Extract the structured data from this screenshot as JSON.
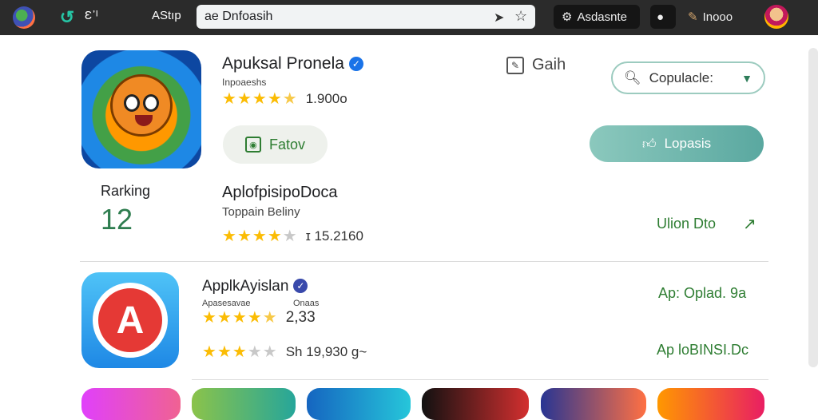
{
  "topbar": {
    "back_label": "ᴇ",
    "app_label": "Ɛ᾿ᴵ",
    "store_label": "AStıp",
    "search_value": "ae Dnfoasih",
    "account_label": "Asdasnte",
    "user_label": "Inooo"
  },
  "app1": {
    "title": "Apuksal Pronela",
    "developer": "Inpoaeshs",
    "rating": "1.900o",
    "stars": 4.5,
    "gaih_label": "Gaih",
    "dropdown_label": "Copulacle:",
    "action_label": "Fatov",
    "install_label": "Lopasis"
  },
  "ranking": {
    "label": "Rarking",
    "value": "12"
  },
  "app2": {
    "title": "AplofpisipoDoca",
    "subtitle": "Toppain Beliny",
    "rating": "ɪ 15.2160",
    "stars": 4,
    "link_label": "Ulion Dto",
    "link_icon": "trend-arrow-icon"
  },
  "app3": {
    "title": "ApplkAyislan",
    "developer_left": "Apasesavae",
    "developer_right": "Onaas",
    "rating": "2,33",
    "stars": 4.5,
    "rating2": "Ѕh 19,930 g~",
    "stars2": 3,
    "link1": "Ap: Oplad. 9a",
    "link2": "Ap loBINSI.Dc"
  },
  "colors": {
    "accent_green": "#2e7d32",
    "teal_button": "#5aa8a0",
    "star_yellow": "#fbbc04",
    "verified_blue": "#1a73e8"
  }
}
